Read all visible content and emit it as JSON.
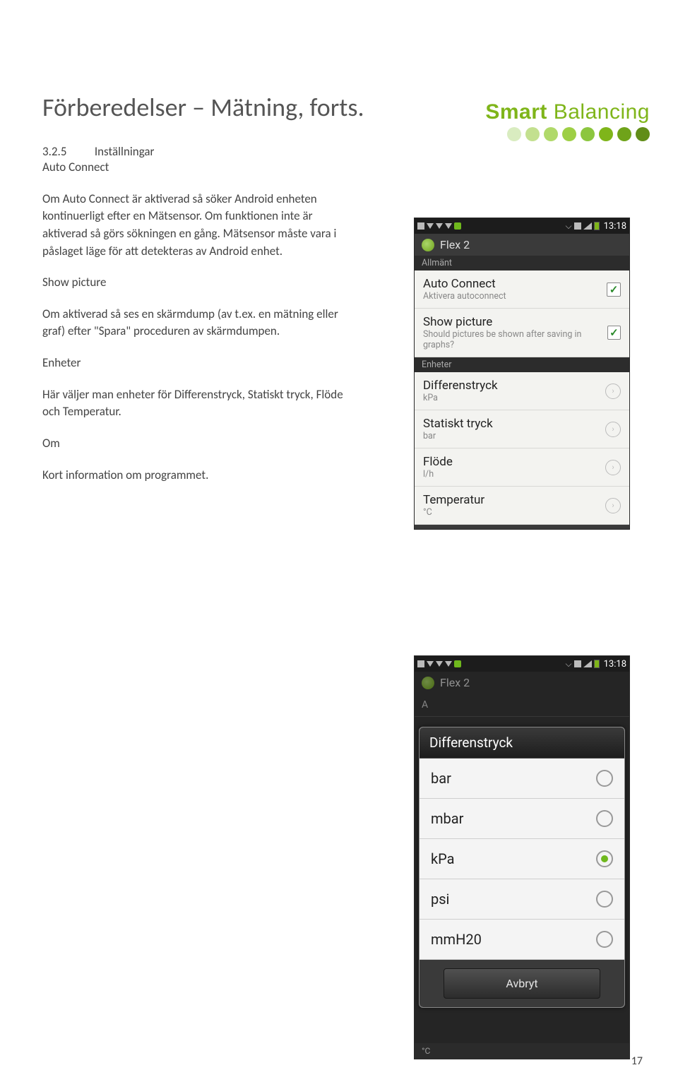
{
  "brand": {
    "bold": "Smart",
    "light": " Balancing"
  },
  "heading": "Förberedelser – Mätning, forts.",
  "section": {
    "num": "3.2.5",
    "title": "Inställningar"
  },
  "auto_connect": {
    "title": "Auto Connect",
    "body": "Om Auto Connect är aktiverad så söker Android enheten kontinuerligt efter en Mätsensor. Om funktionen inte är aktiverad så görs sökningen en gång. Mätsensor måste vara i påslaget läge för att detekteras av Android enhet."
  },
  "show_picture": {
    "title": "Show picture",
    "body": "Om aktiverad så ses en skärmdump (av t.ex. en mätning eller graf) efter \"Spara\" proceduren av skärmdumpen."
  },
  "enheter": {
    "title": "Enheter",
    "body": "Här väljer man enheter för Differenstryck, Statiskt tryck, Flöde och Temperatur."
  },
  "om": {
    "title": "Om",
    "body": "Kort information om programmet."
  },
  "page_number": "17",
  "phone_top": {
    "time": "13:18",
    "app": "Flex 2",
    "sections": {
      "general": "Allmänt",
      "units": "Enheter"
    },
    "rows": {
      "autoconnect": {
        "title": "Auto Connect",
        "sub": "Aktivera autoconnect",
        "checked": true
      },
      "showpic": {
        "title": "Show picture",
        "sub": "Should pictures be shown after saving in graphs?",
        "checked": true
      },
      "diff": {
        "title": "Differenstryck",
        "sub": "kPa"
      },
      "stat": {
        "title": "Statiskt tryck",
        "sub": "bar"
      },
      "flow": {
        "title": "Flöde",
        "sub": "l/h"
      },
      "temp": {
        "title": "Temperatur",
        "sub": "°C"
      }
    }
  },
  "phone_bottom": {
    "time": "13:18",
    "app": "Flex 2",
    "bg_hint": "A",
    "dialog": {
      "title": "Differenstryck",
      "options": [
        "bar",
        "mbar",
        "kPa",
        "psi",
        "mmH20"
      ],
      "selected": "kPa",
      "cancel": "Avbryt"
    },
    "foot": "°C"
  }
}
